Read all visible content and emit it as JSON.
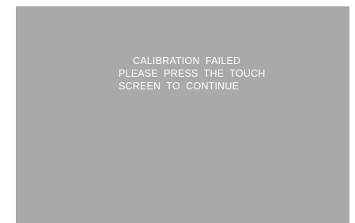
{
  "screen": {
    "background": "#a9a9a9",
    "text_color": "#ffffff",
    "message": {
      "line1": "CALIBRATION  FAILED",
      "line2": "PLEASE  PRESS  THE  TOUCH",
      "line3": "SCREEN  TO  CONTINUE"
    }
  }
}
